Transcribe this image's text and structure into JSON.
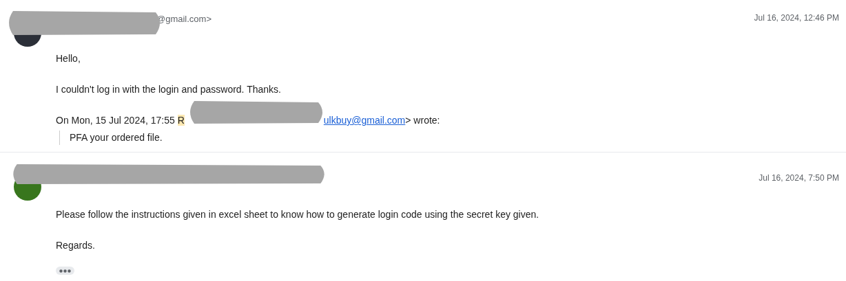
{
  "messages": [
    {
      "sender": "@gmail.com>",
      "date": "Jul 16, 2024, 12:46 PM",
      "color": "#2b2f38",
      "body": [
        "Hello,",
        "I couldn't log in with the login and password. Thanks."
      ],
      "quote_header": {
        "prefix": "On Mon, 15 Jul 2024, 17:55 ",
        "highlight": "R",
        "link": "ulkbuy@gmail.com",
        "suffix": "> wrote:"
      },
      "quoted": "PFA your ordered file.",
      "trimmed": false
    },
    {
      "date": "Jul 16, 2024, 7:50 PM",
      "color": "#38761d",
      "body": [
        "Please follow the instructions given in excel sheet to know how to generate login code using the secret key given.",
        "Regards."
      ],
      "trimmed": true
    }
  ]
}
